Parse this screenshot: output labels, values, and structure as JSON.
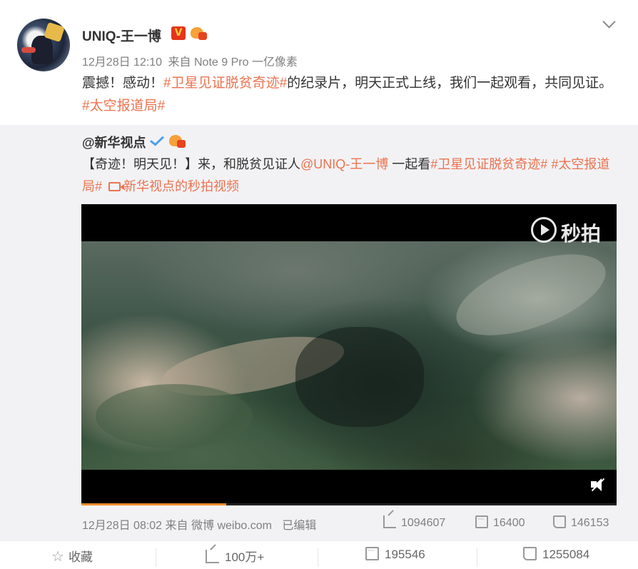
{
  "post": {
    "username": "UNIQ-王一博",
    "badge_v": "V",
    "meta": {
      "time": "12月28日 12:10",
      "source": "来自 Note 9 Pro 一亿像素"
    },
    "text": [
      {
        "t": "震撼！感动！",
        "topic": false
      },
      {
        "t": "#卫星见证脱贫奇迹#",
        "topic": true
      },
      {
        "t": "的纪录片，明天正式上线，我们一起观看，共同见证。",
        "topic": false
      },
      {
        "t": "#太空报道局#",
        "topic": true
      }
    ]
  },
  "repost": {
    "username": "@新华视点",
    "text": [
      {
        "t": "【奇迹！明天见！】来，和脱贫见证人",
        "link": false
      },
      {
        "t": "@UNIQ-王一博",
        "link": true
      },
      {
        "t": " 一起看",
        "link": false
      },
      {
        "t": "#卫星见证脱贫奇迹#",
        "link": true
      },
      {
        "t": " ",
        "link": false
      },
      {
        "t": "#太空报道局#",
        "link": true
      },
      {
        "t": " ",
        "link": false
      }
    ],
    "video_link": "新华视点的秒拍视频",
    "video": {
      "logo": "秒拍",
      "progress": 0.27
    },
    "footer": {
      "time": "12月28日 08:02",
      "source": "来自 微博 weibo.com",
      "edited": "已编辑",
      "shares": "1094607",
      "comments": "16400",
      "likes": "146153"
    }
  },
  "actions": {
    "favorite": "收藏",
    "forward": "100万+",
    "comment": "195546",
    "like": "1255084"
  },
  "colors": {
    "topic": "#eb7350",
    "repost_bg": "#f2f2f5",
    "progress": "#f28b2c"
  },
  "icons": [
    "chevron-down-icon",
    "play-logo-icon",
    "mute-icon",
    "share-icon",
    "comment-icon",
    "like-icon",
    "star-icon"
  ]
}
